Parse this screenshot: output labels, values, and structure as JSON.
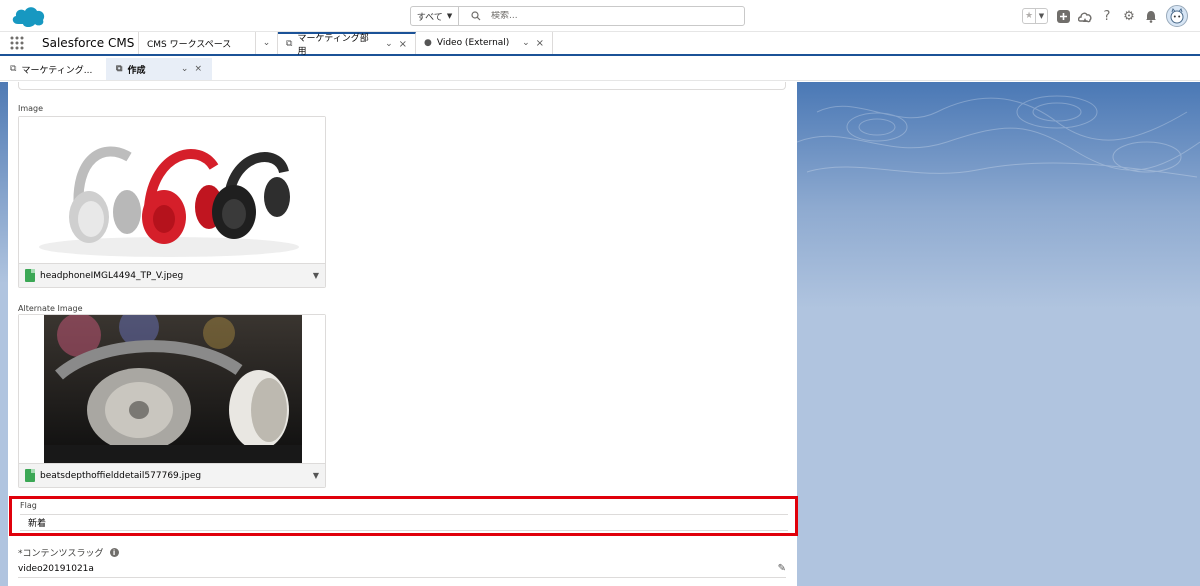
{
  "header": {
    "search_scope": "すべて",
    "search_placeholder": "検索...",
    "icons": [
      "favorite-star-icon",
      "favorites-list-icon",
      "global-add-icon",
      "trailhead-icon",
      "help-icon",
      "setup-gear-icon",
      "notification-bell-icon",
      "user-avatar"
    ]
  },
  "nav": {
    "app_name": "Salesforce CMS",
    "tabs": [
      {
        "label": "CMS ワークスペース"
      },
      {
        "label": "マーケティング部用"
      },
      {
        "label": "Video (External)"
      }
    ]
  },
  "subtabs": [
    {
      "label": "マーケティング..."
    },
    {
      "label": "作成"
    }
  ],
  "form": {
    "image_label": "Image",
    "image_file": "headphoneIMGL4494_TP_V.jpeg",
    "alt_image_label": "Alternate Image",
    "alt_image_file": "beatsdepthoffielddetail577769.jpeg",
    "flag_label": "Flag",
    "flag_value": "新着",
    "slug_label": "*コンテンツスラッグ",
    "slug_value": "video20191021a"
  },
  "colors": {
    "brand_blue": "#1b5297",
    "highlight_red": "#e0000b",
    "file_green": "#3ba755"
  }
}
